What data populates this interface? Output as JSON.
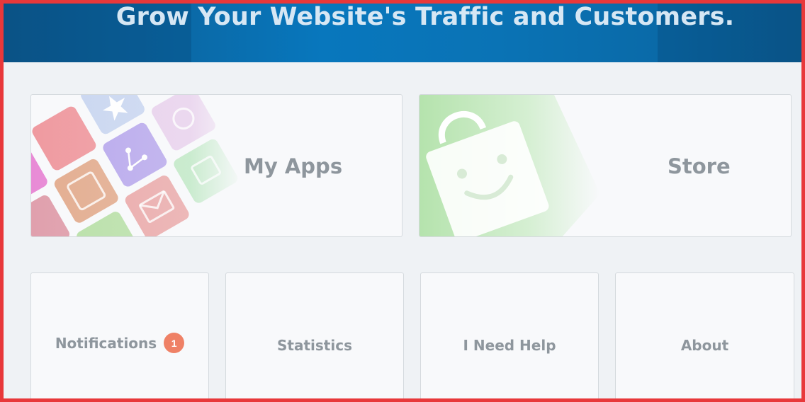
{
  "hero": {
    "title": "Grow Your Website's Traffic and Customers."
  },
  "cards": {
    "apps": {
      "label": "My Apps",
      "icon": "apps-grid-icon"
    },
    "store": {
      "label": "Store",
      "icon": "shopping-bag-icon"
    }
  },
  "tiles": [
    {
      "label": "Notifications",
      "badge": "1"
    },
    {
      "label": "Statistics"
    },
    {
      "label": "I Need Help"
    },
    {
      "label": "About"
    }
  ],
  "colors": {
    "hero": "#0877bd",
    "badge": "#ef8166",
    "text": "#8e969d",
    "frame": "#e8383a"
  }
}
